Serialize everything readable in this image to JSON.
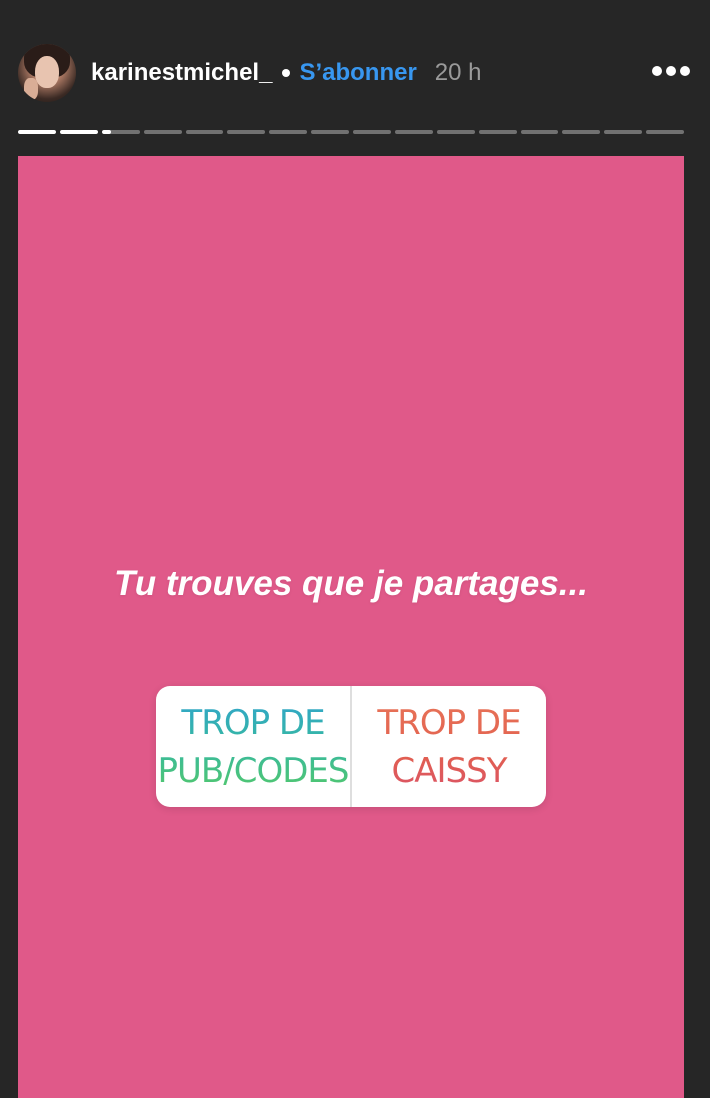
{
  "header": {
    "username": "karinestmichel_",
    "follow_label": "S’abonner",
    "time": "20 h",
    "avatar_icon": "profile-photo",
    "more_icon": "more-horizontal-icon"
  },
  "progress": {
    "segments": 16,
    "current_index": 2,
    "current_fill": 0.25
  },
  "story": {
    "background_color": "#e05989",
    "question": "Tu trouves que je partages...",
    "poll": {
      "option_a_line1": "TROP DE",
      "option_a_line2": "PUB/CODES",
      "option_b_line1": "TROP DE",
      "option_b_line2": "CAISSY"
    }
  },
  "colors": {
    "follow": "#3897f0",
    "background": "#262626"
  }
}
